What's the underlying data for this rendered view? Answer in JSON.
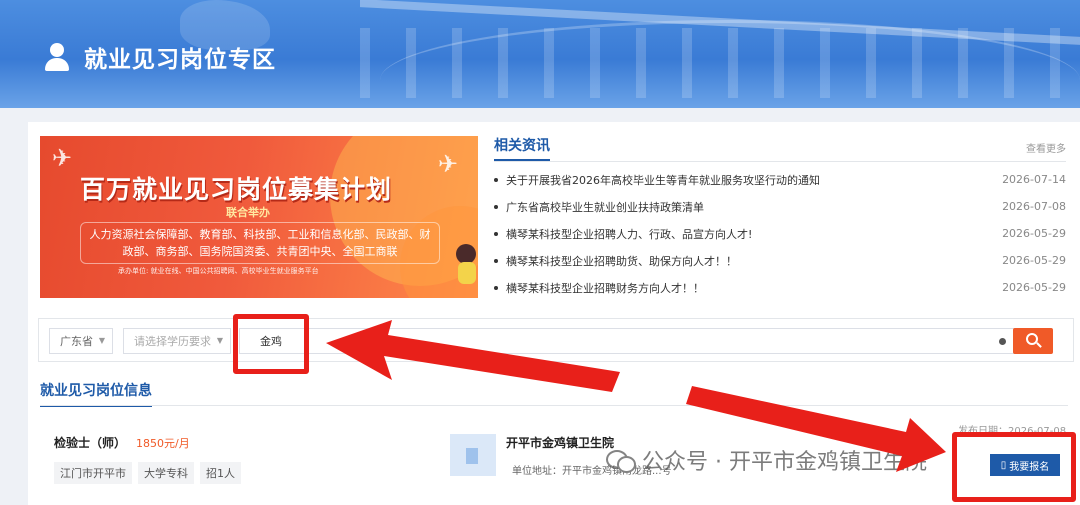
{
  "header": {
    "title": "就业见习岗位专区"
  },
  "banner": {
    "title": "百万就业见习岗位募集计划",
    "subtitle": "联合举办",
    "depts": "人力资源社会保障部、教育部、科技部、工业和信息化部、民政部、财政部、商务部、国务院国资委、共青团中央、全国工商联",
    "hosts": "承办单位: 就业在线、中国公共招聘网、高校毕业生就业服务平台"
  },
  "news": {
    "tab": "相关资讯",
    "more": "查看更多",
    "items": [
      {
        "title": "关于开展我省2026年高校毕业生等青年就业服务攻坚行动的通知",
        "date": "2026-07-14"
      },
      {
        "title": "广东省高校毕业生就业创业扶持政策清单",
        "date": "2026-07-08"
      },
      {
        "title": "横琴某科技型企业招聘人力、行政、品宣方向人才!",
        "date": "2026-05-29"
      },
      {
        "title": "横琴某科技型企业招聘助货、助保方向人才！！",
        "date": "2026-05-29"
      },
      {
        "title": "横琴某科技型企业招聘财务方向人才！！",
        "date": "2026-05-29"
      }
    ]
  },
  "search": {
    "province": "广东省",
    "education_placeholder": "请选择学历要求",
    "keyword": "金鸡"
  },
  "section": {
    "title": "就业见习岗位信息"
  },
  "job": {
    "name": "检验士（师）",
    "salary": "1850元/月",
    "tags": [
      "江门市开平市",
      "大学专科",
      "招1人"
    ],
    "company": "开平市金鸡镇卫生院",
    "address": "单位地址：开平市金鸡镇南龙路...号",
    "date": "发布日期：2026-07-08",
    "apply_label": "我要报名"
  },
  "watermark": {
    "text": "公众号 · 开平市金鸡镇卫生院"
  },
  "colors": {
    "brand_blue": "#1e5aa8",
    "accent_orange": "#f05a28",
    "annotation_red": "#e8201a"
  }
}
